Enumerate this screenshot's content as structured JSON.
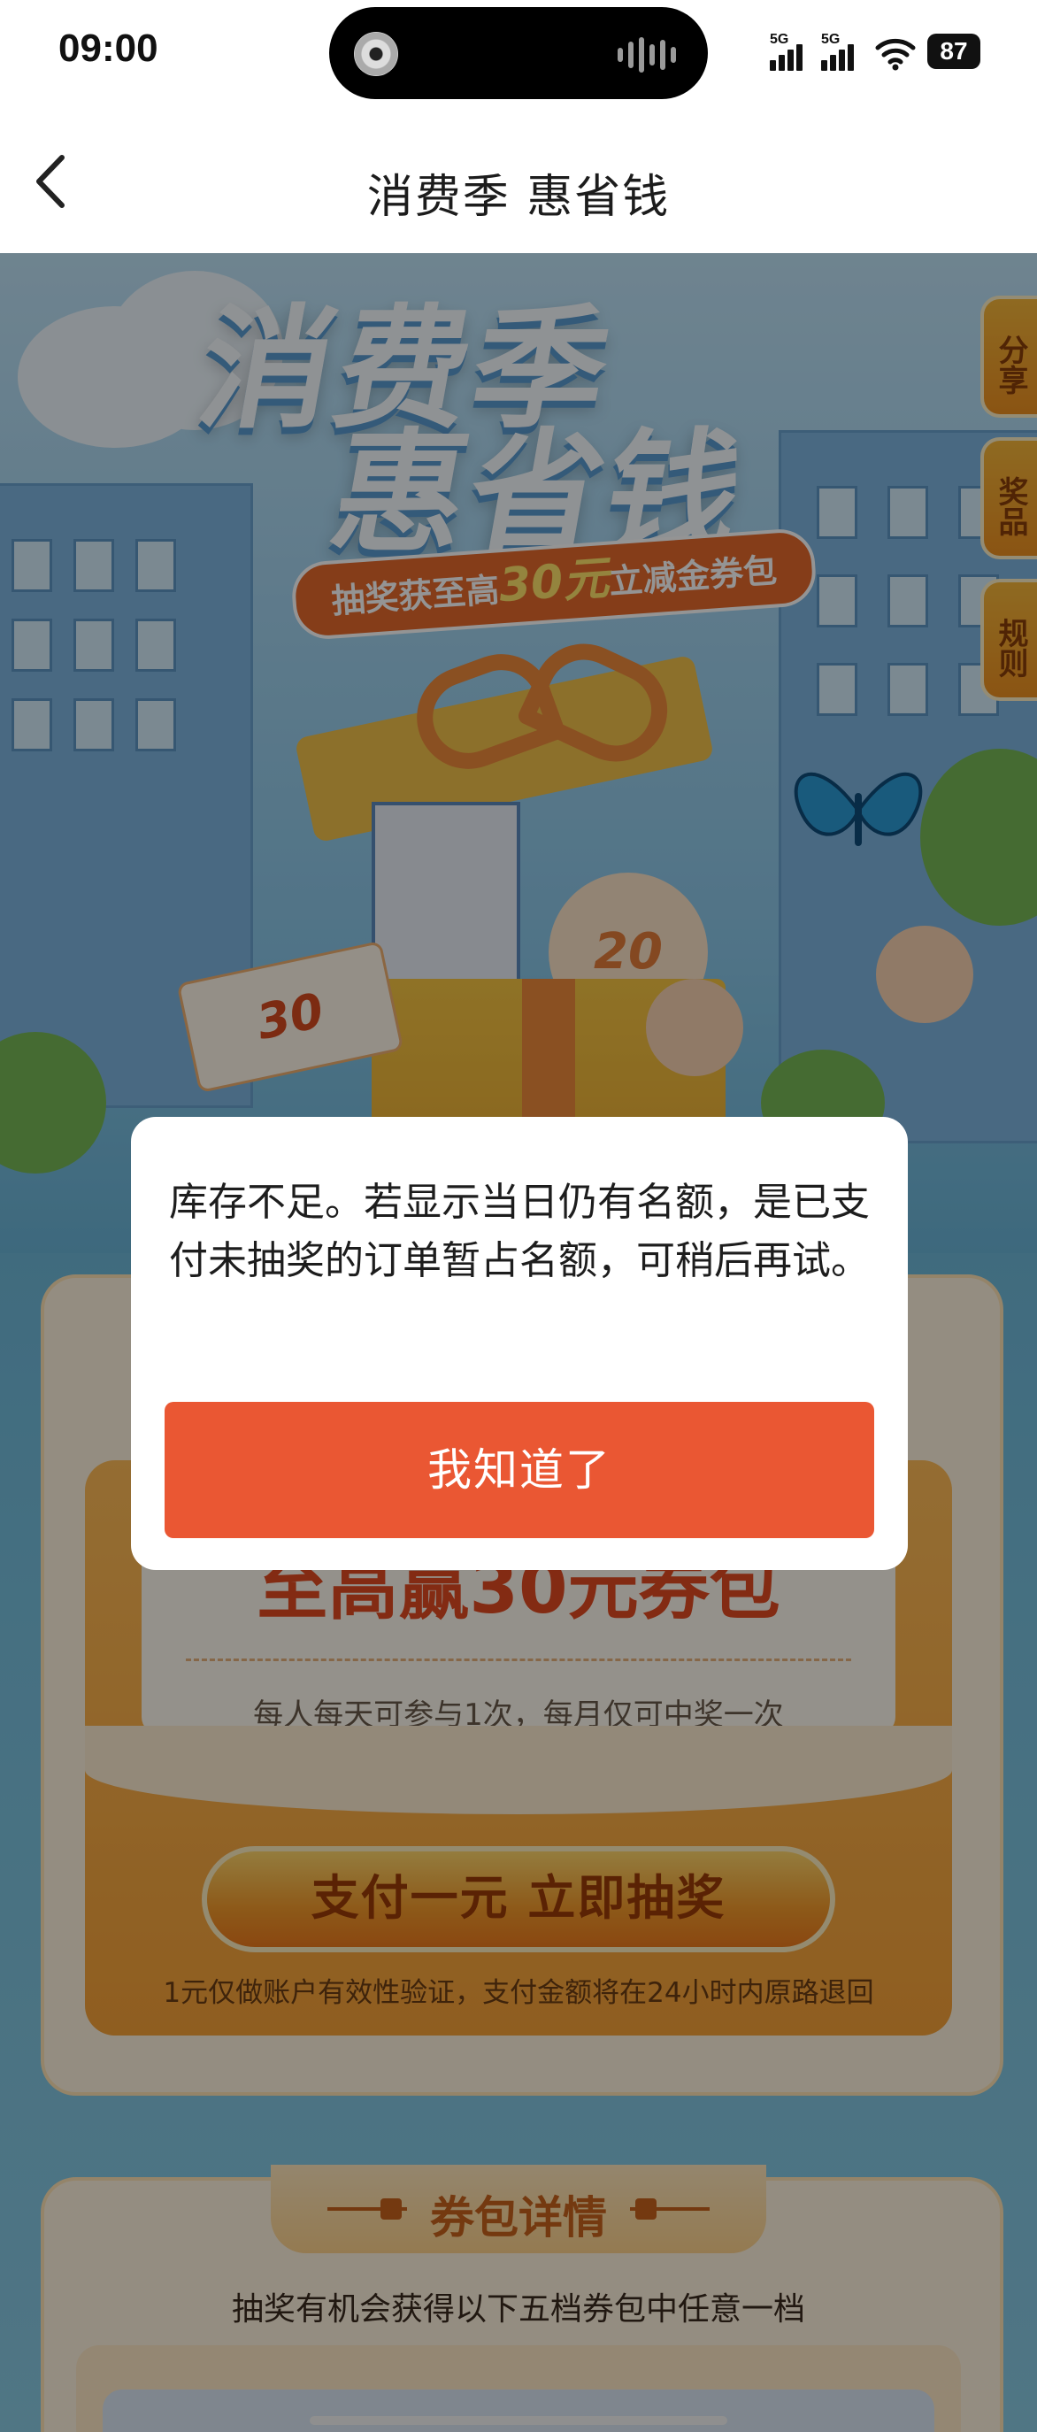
{
  "status_bar": {
    "time": "09:00",
    "signal_1_label": "5G",
    "signal_2_label": "5G",
    "battery": "87",
    "icons": [
      "music-disc-icon",
      "audio-wave-icon",
      "signal-icon",
      "signal-icon",
      "wifi-icon",
      "battery-icon"
    ]
  },
  "nav": {
    "title": "消费季 惠省钱",
    "back_icon": "chevron-left-icon"
  },
  "banner": {
    "title_line1": "消费季",
    "title_line2": "惠省钱",
    "ribbon_prefix": "抽奖获至高",
    "ribbon_amount": "30元",
    "ribbon_suffix": "立减金券包",
    "coupon_card_text": "30",
    "coupon_ball_text": "20"
  },
  "side_tabs": [
    {
      "label": "分享"
    },
    {
      "label": "奖品"
    },
    {
      "label": "规则"
    }
  ],
  "lottery": {
    "amount_text": "至高赢30元券包",
    "note": "每人每天可参与1次，每月仅可中奖一次",
    "draw_button": "支付一元 立即抽奖",
    "draw_note": "1元仅做账户有效性验证，支付金额将在24小时内原路退回"
  },
  "details": {
    "title": "券包详情",
    "subtitle": "抽奖有机会获得以下五档券包中任意一档"
  },
  "dialog": {
    "message": "库存不足。若显示当日仍有名额，是已支付未抽奖的订单暂占名额，可稍后再试。",
    "button": "我知道了"
  },
  "colors": {
    "accent": "#ea5733",
    "banner_sky": "#9fd1ee",
    "orange": "#f7a238",
    "card_bg": "#fff3df"
  }
}
